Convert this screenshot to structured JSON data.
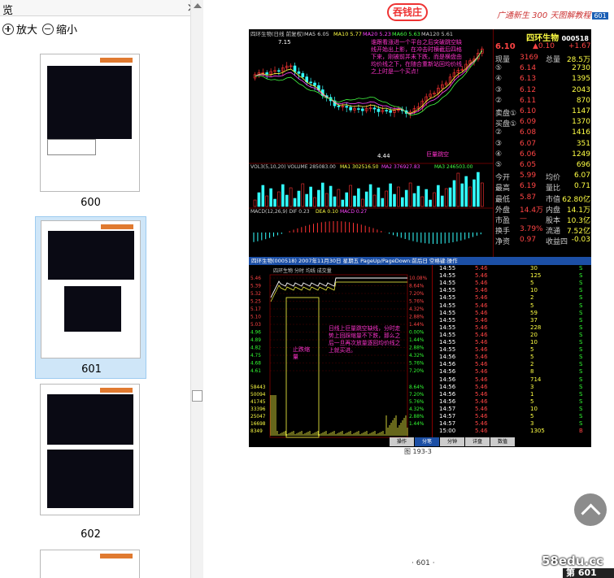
{
  "panel": {
    "title": "览",
    "zoom_in": "放大",
    "zoom_out": "缩小",
    "thumbnails": [
      {
        "label": "600",
        "selected": false
      },
      {
        "label": "601",
        "selected": true
      },
      {
        "label": "602",
        "selected": false
      }
    ]
  },
  "doc": {
    "brand_logo": "吞钱庄",
    "header": "广通新生 300 天图解教程",
    "header_page": "601",
    "figure_caption": "图 193-3",
    "page_footer": "· 601 ·",
    "stock": {
      "top_label": "四环生物(日线 前复权)",
      "ma_labels": [
        "MA5 6.05",
        "MA10 5.77",
        "MA20 5.23",
        "MA60 5.63",
        "MA120 5.61"
      ],
      "high_label": "7.15",
      "low_label": "4.44",
      "annotation_top": "谁跟看涨进一个平台之后突破跳空缺线开始出上影，在冲击时横截后四格下来，刚被前并未下跌，而是横盘由均价线之下，在随合重新站回均价线之上时是一个买点！",
      "annotation_gap": "巨量跳空",
      "vol_label": "VOL3(5,10,20) VOLUME 285083.00",
      "vol_ma": [
        "MA1 302516.50",
        "MA2 376927.83",
        "MA3 246503.00"
      ],
      "macd_label": "MACD(12,26,9) DIF 0.23",
      "macd_dea": "DEA 0.10",
      "macd_val": "MACD 0.27",
      "quote": {
        "name": "四环生物",
        "code": "000518",
        "price": "6.10",
        "change": "▲0.10",
        "pct": "+1.67",
        "rows": [
          {
            "k": "现量",
            "v": "3169",
            "k2": "总量",
            "v2": "28.5万"
          },
          {
            "k": "⑤",
            "v": "6.14",
            "v2": "2730"
          },
          {
            "k": "④",
            "v": "6.13",
            "v2": "1395"
          },
          {
            "k": "③",
            "v": "6.12",
            "v2": "2043"
          },
          {
            "k": "②",
            "v": "6.11",
            "v2": "870"
          },
          {
            "k": "卖盘①",
            "v": "6.10",
            "v2": "1147"
          },
          {
            "k": "买盘①",
            "v": "6.09",
            "v2": "1370"
          },
          {
            "k": "②",
            "v": "6.08",
            "v2": "1416"
          },
          {
            "k": "③",
            "v": "6.07",
            "v2": "351"
          },
          {
            "k": "④",
            "v": "6.06",
            "v2": "1249"
          },
          {
            "k": "⑤",
            "v": "6.05",
            "v2": "696"
          },
          {
            "k": "今开",
            "v": "5.99",
            "k2": "均价",
            "v2": "6.07"
          },
          {
            "k": "最高",
            "v": "6.19",
            "k2": "量比",
            "v2": "0.71"
          },
          {
            "k": "最低",
            "v": "5.87",
            "k2": "市值",
            "v2": "62.80亿"
          },
          {
            "k": "外盘",
            "v": "14.4万",
            "k2": "内盘",
            "v2": "14.1万"
          },
          {
            "k": "市盈",
            "v": "—",
            "k2": "股本",
            "v2": "10.3亿"
          },
          {
            "k": "换手",
            "v": "3.79%",
            "k2": "流通",
            "v2": "7.52亿"
          },
          {
            "k": "净资",
            "v": "0.97",
            "k2": "收益四",
            "v2": "-0.03"
          }
        ]
      },
      "intraday": {
        "title": "四环生物(000518) 2007年11月30日 星期五 PageUp/PageDown:前后日 空格键:操作",
        "left_prices": [
          "5.46",
          "5.39",
          "5.32",
          "5.25",
          "5.17",
          "5.10",
          "5.03",
          "4.96",
          "4.89",
          "4.82",
          "4.75",
          "4.68",
          "4.61"
        ],
        "right_pcts": [
          "10.08%",
          "8.64%",
          "7.20%",
          "5.76%",
          "4.32%",
          "2.88%",
          "1.44%",
          "0.00%",
          "1.44%",
          "2.88%",
          "4.32%",
          "5.76%",
          "7.20%"
        ],
        "vol_left": [
          "58443",
          "50094",
          "41745",
          "33396",
          "25047",
          "16698",
          "8349"
        ],
        "vol_right": [
          "8.64%",
          "7.20%",
          "5.76%",
          "4.32%",
          "2.88%",
          "1.44%"
        ],
        "header_label": "四环生物  分时  均线  成交量",
        "annotation": "日线上巨量跳空缺线，分时走势上回踩缩量不下跌，那么之后一旦再次放量逐回均价线之上就买进。",
        "annotation_vol": "止跌缩量",
        "tab_labels": [
          "操作",
          "分笔",
          "分钟",
          "详盘",
          "数值"
        ],
        "ticks": [
          {
            "t": "14:55",
            "p": "5.46",
            "v": "30",
            "s": "S"
          },
          {
            "t": "14:55",
            "p": "5.46",
            "v": "125",
            "s": "S"
          },
          {
            "t": "14:55",
            "p": "5.46",
            "v": "5",
            "s": "S"
          },
          {
            "t": "14:55",
            "p": "5.46",
            "v": "10",
            "s": "S"
          },
          {
            "t": "14:55",
            "p": "5.46",
            "v": "2",
            "s": "S"
          },
          {
            "t": "14:55",
            "p": "5.46",
            "v": "5",
            "s": "S"
          },
          {
            "t": "14:55",
            "p": "5.46",
            "v": "59",
            "s": "S"
          },
          {
            "t": "14:55",
            "p": "5.46",
            "v": "37",
            "s": "S"
          },
          {
            "t": "14:55",
            "p": "5.46",
            "v": "228",
            "s": "S"
          },
          {
            "t": "14:55",
            "p": "5.46",
            "v": "20",
            "s": "S"
          },
          {
            "t": "14:55",
            "p": "5.46",
            "v": "10",
            "s": "S"
          },
          {
            "t": "14:55",
            "p": "5.46",
            "v": "5",
            "s": "S"
          },
          {
            "t": "14:56",
            "p": "5.46",
            "v": "5",
            "s": "S"
          },
          {
            "t": "14:56",
            "p": "5.46",
            "v": "2",
            "s": "S"
          },
          {
            "t": "14:56",
            "p": "5.46",
            "v": "8",
            "s": "S"
          },
          {
            "t": "14:56",
            "p": "5.46",
            "v": "714",
            "s": "S"
          },
          {
            "t": "14:56",
            "p": "5.46",
            "v": "3",
            "s": "S"
          },
          {
            "t": "14:56",
            "p": "5.46",
            "v": "1",
            "s": "S"
          },
          {
            "t": "14:56",
            "p": "5.46",
            "v": "5",
            "s": "S"
          },
          {
            "t": "14:57",
            "p": "5.46",
            "v": "10",
            "s": "S"
          },
          {
            "t": "14:57",
            "p": "5.46",
            "v": "5",
            "s": "S"
          },
          {
            "t": "14:57",
            "p": "5.46",
            "v": "3",
            "s": "S"
          },
          {
            "t": "15:00",
            "p": "5.46",
            "v": "1305",
            "s": "B"
          }
        ]
      }
    }
  },
  "watermark": "58edu.cc",
  "page_badge": "第 601"
}
